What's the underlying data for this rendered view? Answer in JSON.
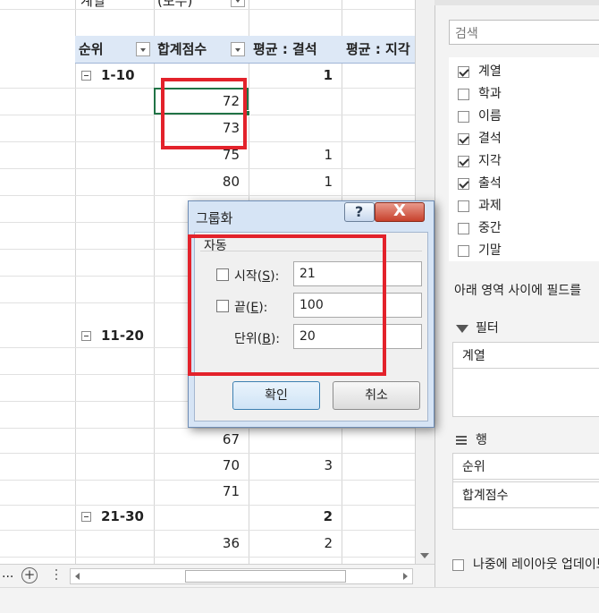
{
  "sheet": {
    "top_row": {
      "field": "계열",
      "value": "(모두)"
    },
    "headers": {
      "rank": "순위",
      "total_score": "합계점수",
      "avg_absence": "평균 : 결석",
      "avg_late": "평균 : 지각"
    },
    "groups": [
      {
        "label": "1-10",
        "absence": "1"
      },
      {
        "label": "11-20"
      },
      {
        "label": "21-30",
        "absence": "2"
      }
    ],
    "rows_g1": [
      {
        "score": "72",
        "absence": ""
      },
      {
        "score": "73",
        "absence": ""
      },
      {
        "score": "75",
        "absence": "1"
      },
      {
        "score": "80",
        "absence": "1"
      }
    ],
    "rows_g2": [
      {
        "score": "67",
        "absence": ""
      },
      {
        "score": "70",
        "absence": "3"
      },
      {
        "score": "71",
        "absence": ""
      }
    ],
    "rows_g3": [
      {
        "score": "36",
        "absence": "2"
      }
    ]
  },
  "bottom": {
    "dots": "...",
    "add_sheet": "+"
  },
  "pane": {
    "search_placeholder": "검색",
    "fields": [
      {
        "label": "계열",
        "checked": true
      },
      {
        "label": "학과",
        "checked": false
      },
      {
        "label": "이름",
        "checked": false
      },
      {
        "label": "결석",
        "checked": true
      },
      {
        "label": "지각",
        "checked": true
      },
      {
        "label": "출석",
        "checked": true
      },
      {
        "label": "과제",
        "checked": false
      },
      {
        "label": "중간",
        "checked": false
      },
      {
        "label": "기말",
        "checked": false
      }
    ],
    "note": "아래 영역 사이에 필드를",
    "filter_label": "필터",
    "filter_items": [
      "계열"
    ],
    "row_label": "행",
    "row_items": [
      "순위",
      "합계점수"
    ],
    "defer_label": "나중에 레이아웃 업데이트"
  },
  "dialog": {
    "title": "그룹화",
    "help": "?",
    "close": "X",
    "group_label": "자동",
    "start_label_pre": "시작(",
    "start_key": "S",
    "start_label_post": "):",
    "start_value": "21",
    "end_label_pre": "끝(",
    "end_key": "E",
    "end_label_post": "):",
    "end_value": "100",
    "step_label_pre": "단위(",
    "step_key": "B",
    "step_label_post": "):",
    "step_value": "20",
    "ok": "확인",
    "cancel": "취소"
  },
  "colors": {
    "highlight_red": "#e3222b",
    "active_cell": "#217346",
    "header_bg": "#dde8f6"
  }
}
